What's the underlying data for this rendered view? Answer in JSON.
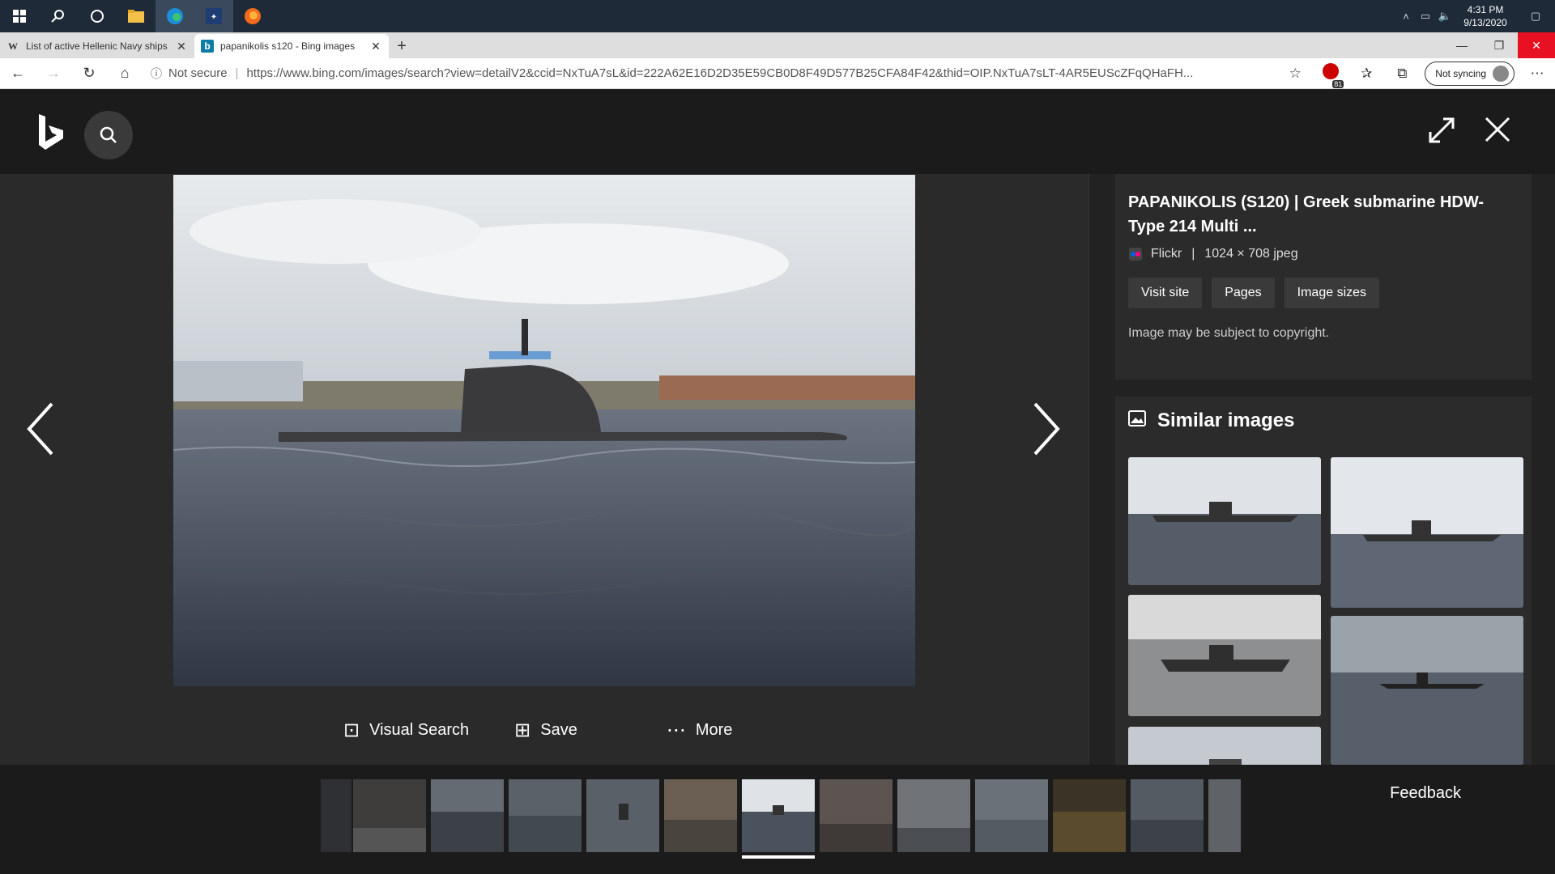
{
  "taskbar": {
    "clock_time": "4:31 PM",
    "clock_date": "9/13/2020"
  },
  "tabs": [
    {
      "title": "List of active Hellenic Navy ships",
      "favicon": "W"
    },
    {
      "title": "papanikolis s120 - Bing images",
      "favicon": "b"
    }
  ],
  "addressbar": {
    "security": "Not secure",
    "url": "https://www.bing.com/images/search?view=detailV2&ccid=NxTuA7sL&id=222A62E16D2D35E59CB0D8F49D577B25CFA84F42&thid=OIP.NxTuA7sLT-4AR5EUScZFqQHaFH...",
    "sync_label": "Not syncing",
    "extension_badge": "81"
  },
  "detail": {
    "title": "PAPANIKOLIS (S120) | Greek submarine HDW-Type 214 Multi ...",
    "source": "Flickr",
    "dimensions": "1024 × 708 jpeg",
    "meta_separator": "|",
    "buttons": [
      "Visit site",
      "Pages",
      "Image sizes"
    ],
    "copyright": "Image may be subject to copyright.",
    "similar_heading": "Similar images"
  },
  "actions": {
    "visual_search": "Visual Search",
    "save": "Save",
    "more": "More"
  },
  "feedback": "Feedback",
  "colors": {
    "close_red": "#e81123",
    "overlay_bg": "#222222",
    "panel_card": "#2b2b2b"
  }
}
